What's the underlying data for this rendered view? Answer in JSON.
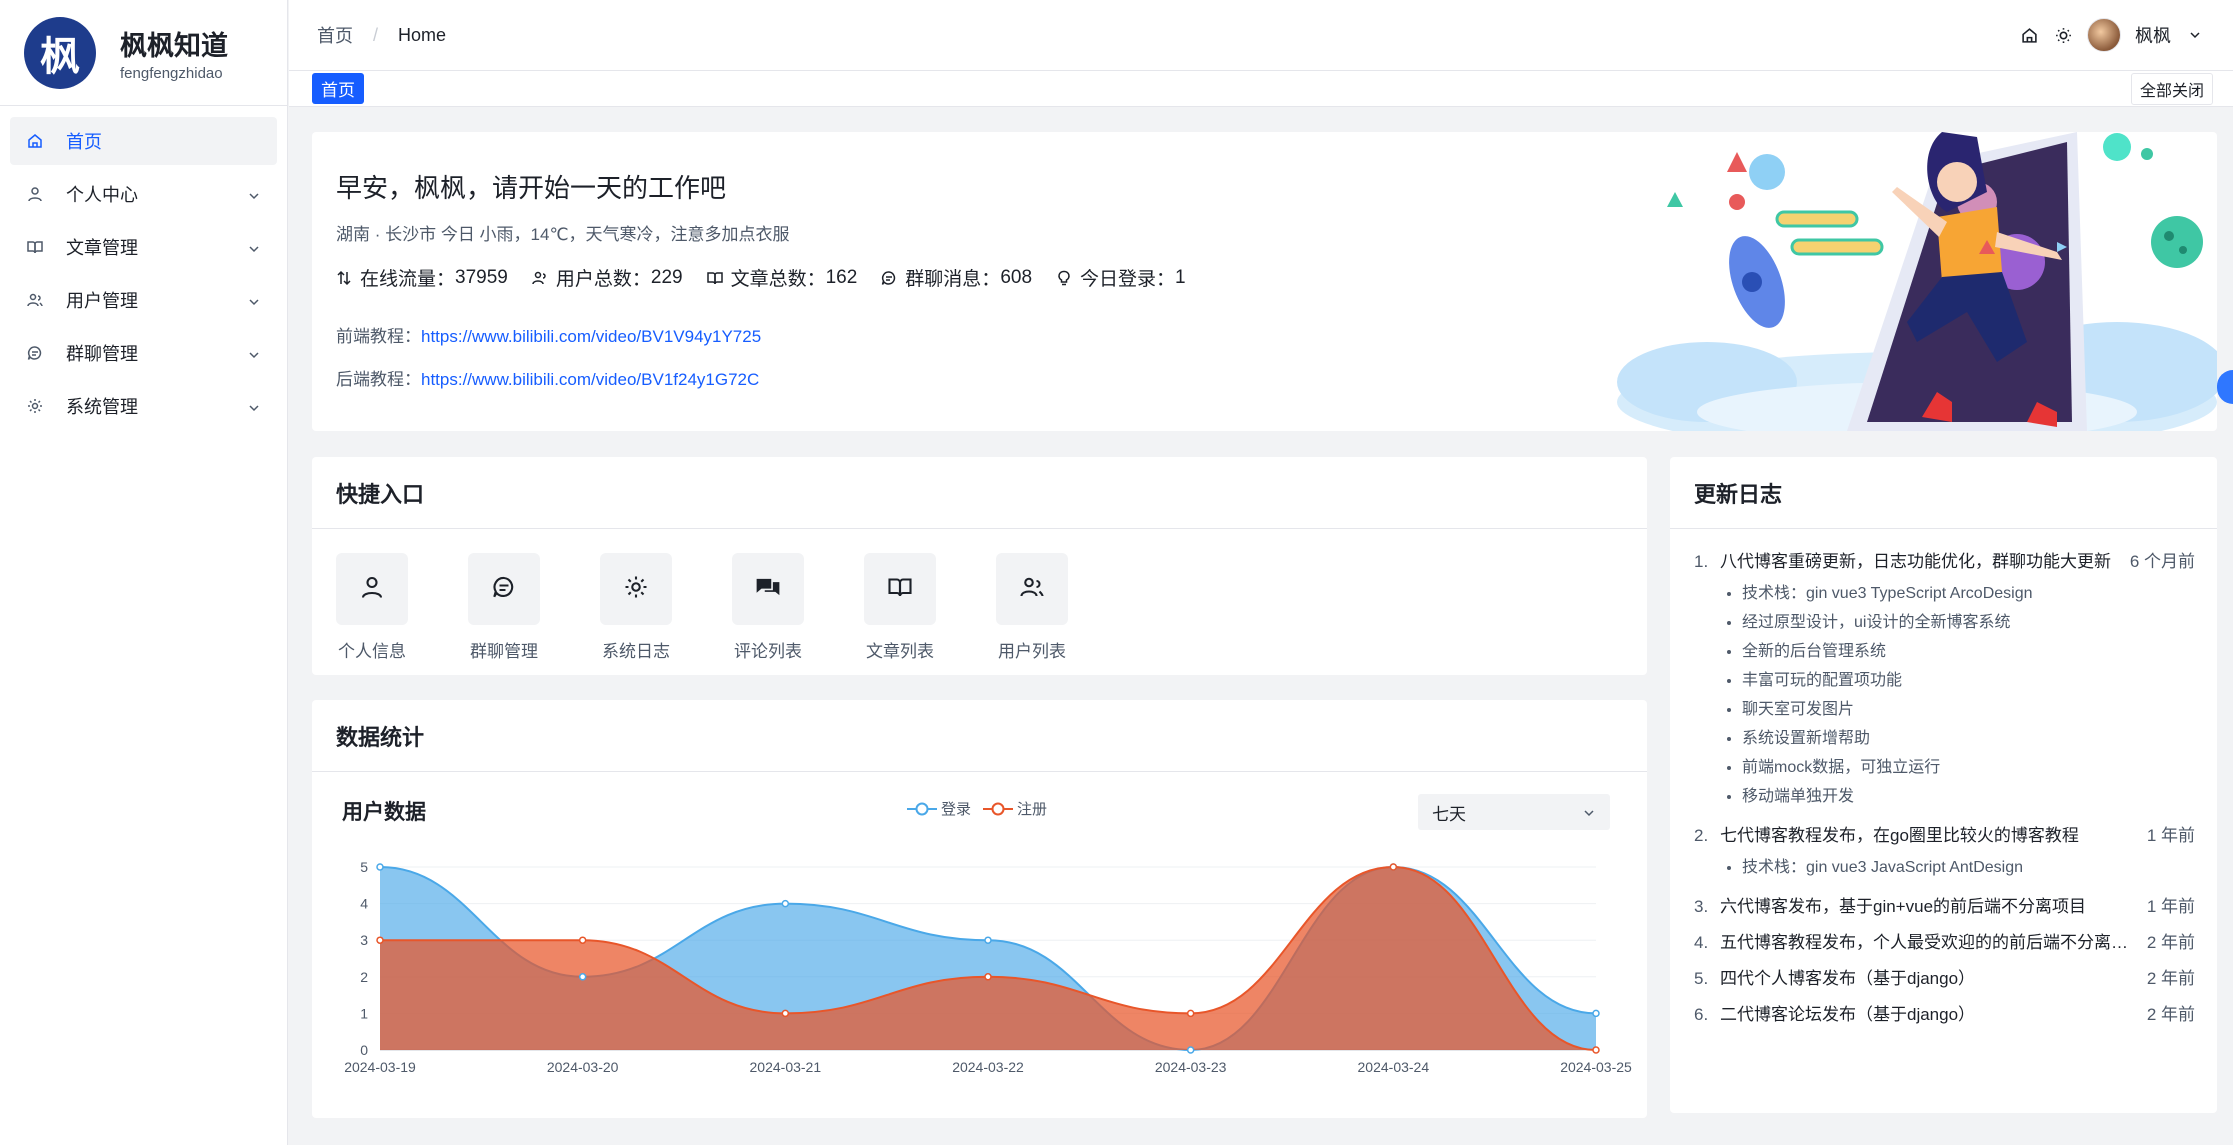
{
  "brand": {
    "title": "枫枫知道",
    "subtitle": "fengfengzhidao",
    "logo_char": "枫"
  },
  "sidebar": {
    "items": [
      {
        "label": "首页",
        "icon": "home-icon",
        "active": true
      },
      {
        "label": "个人中心",
        "icon": "user-icon"
      },
      {
        "label": "文章管理",
        "icon": "book-icon"
      },
      {
        "label": "用户管理",
        "icon": "users-icon"
      },
      {
        "label": "群聊管理",
        "icon": "chat-icon"
      },
      {
        "label": "系统管理",
        "icon": "gear-icon"
      }
    ]
  },
  "header": {
    "breadcrumb": [
      "首页",
      "Home"
    ],
    "breadcrumb_sep": "/",
    "user_name": "枫枫"
  },
  "tabs": {
    "active": "首页",
    "close_all": "全部关闭"
  },
  "welcome": {
    "greeting": "早安，枫枫，请开始一天的工作吧",
    "weather": "湖南 · 长沙市 今日 小雨，14℃，天气寒冷，注意多加点衣服",
    "stats": [
      {
        "label": "在线流量：",
        "value": "37959",
        "icon": "sort-icon"
      },
      {
        "label": "用户总数：",
        "value": "229",
        "icon": "users-icon"
      },
      {
        "label": "文章总数：",
        "value": "162",
        "icon": "book-icon"
      },
      {
        "label": "群聊消息：",
        "value": "608",
        "icon": "chat-icon"
      },
      {
        "label": "今日登录：",
        "value": "1",
        "icon": "bulb-icon"
      }
    ],
    "links": [
      {
        "label": "前端教程：",
        "url": "https://www.bilibili.com/video/BV1V94y1Y725"
      },
      {
        "label": "后端教程：",
        "url": "https://www.bilibili.com/video/BV1f24y1G72C"
      }
    ]
  },
  "quick": {
    "title": "快捷入口",
    "items": [
      {
        "label": "个人信息",
        "icon": "user-icon"
      },
      {
        "label": "群聊管理",
        "icon": "chat-icon"
      },
      {
        "label": "系统日志",
        "icon": "gear-icon"
      },
      {
        "label": "评论列表",
        "icon": "comments-icon"
      },
      {
        "label": "文章列表",
        "icon": "book-icon"
      },
      {
        "label": "用户列表",
        "icon": "users-icon"
      }
    ]
  },
  "stats_card": {
    "title": "数据统计",
    "chart_title": "用户数据",
    "range_value": "七天"
  },
  "chart_data": {
    "type": "area",
    "x": [
      "2024-03-19",
      "2024-03-20",
      "2024-03-21",
      "2024-03-22",
      "2024-03-23",
      "2024-03-24",
      "2024-03-25"
    ],
    "series": [
      {
        "name": "登录",
        "values": [
          5,
          2,
          4,
          3,
          0,
          5,
          1
        ],
        "color": "#4aa8e8"
      },
      {
        "name": "注册",
        "values": [
          3,
          3,
          1,
          2,
          1,
          5,
          0
        ],
        "color": "#e8562a"
      }
    ],
    "yticks": [
      0,
      1,
      2,
      3,
      4,
      5
    ],
    "ylim": [
      0,
      5
    ],
    "legend": "top-center",
    "grid": true
  },
  "log": {
    "title": "更新日志",
    "items": [
      {
        "num": "1.",
        "title": "八代博客重磅更新，日志功能优化，群聊功能大更新",
        "time": "6 个月前",
        "bullets": [
          "技术栈：gin vue3 TypeScript ArcoDesign",
          "经过原型设计，ui设计的全新博客系统",
          "全新的后台管理系统",
          "丰富可玩的配置项功能",
          "聊天室可发图片",
          "系统设置新增帮助",
          "前端mock数据，可独立运行",
          "移动端单独开发"
        ]
      },
      {
        "num": "2.",
        "title": "七代博客教程发布，在go圈里比较火的博客教程",
        "time": "1 年前",
        "bullets": [
          "技术栈：gin vue3 JavaScript AntDesign"
        ]
      },
      {
        "num": "3.",
        "title": "六代博客发布，基于gin+vue的前后端不分离项目",
        "time": "1 年前",
        "bullets": []
      },
      {
        "num": "4.",
        "title": "五代博客教程发布，个人最受欢迎的的前后端不分离博客",
        "time": "2 年前",
        "bullets": []
      },
      {
        "num": "5.",
        "title": "四代个人博客发布（基于django）",
        "time": "2 年前",
        "bullets": []
      },
      {
        "num": "6.",
        "title": "二代博客论坛发布（基于django）",
        "time": "2 年前",
        "bullets": []
      }
    ]
  }
}
